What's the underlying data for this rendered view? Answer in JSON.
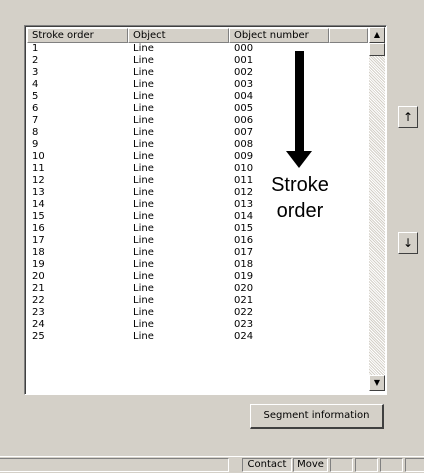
{
  "table": {
    "columns": [
      "Stroke order",
      "Object",
      "Object number",
      ""
    ],
    "rows": [
      [
        "1",
        "Line",
        "000"
      ],
      [
        "2",
        "Line",
        "001"
      ],
      [
        "3",
        "Line",
        "002"
      ],
      [
        "4",
        "Line",
        "003"
      ],
      [
        "5",
        "Line",
        "004"
      ],
      [
        "6",
        "Line",
        "005"
      ],
      [
        "7",
        "Line",
        "006"
      ],
      [
        "8",
        "Line",
        "007"
      ],
      [
        "9",
        "Line",
        "008"
      ],
      [
        "10",
        "Line",
        "009"
      ],
      [
        "11",
        "Line",
        "010"
      ],
      [
        "12",
        "Line",
        "011"
      ],
      [
        "13",
        "Line",
        "012"
      ],
      [
        "14",
        "Line",
        "013"
      ],
      [
        "15",
        "Line",
        "014"
      ],
      [
        "16",
        "Line",
        "015"
      ],
      [
        "17",
        "Line",
        "016"
      ],
      [
        "18",
        "Line",
        "017"
      ],
      [
        "19",
        "Line",
        "018"
      ],
      [
        "20",
        "Line",
        "019"
      ],
      [
        "21",
        "Line",
        "020"
      ],
      [
        "22",
        "Line",
        "021"
      ],
      [
        "23",
        "Line",
        "022"
      ],
      [
        "24",
        "Line",
        "023"
      ],
      [
        "25",
        "Line",
        "024"
      ]
    ]
  },
  "scrollbar": {
    "up_glyph": "▲",
    "down_glyph": "▼"
  },
  "annotation": {
    "line1": "Stroke",
    "line2": "order",
    "arrow_icon": "down-arrow-icon"
  },
  "side_buttons": {
    "move_up": "↑",
    "move_down": "↓"
  },
  "segment_button": {
    "label": "Segment information"
  },
  "statusbar": {
    "contact": "Contact",
    "move": "Move"
  }
}
